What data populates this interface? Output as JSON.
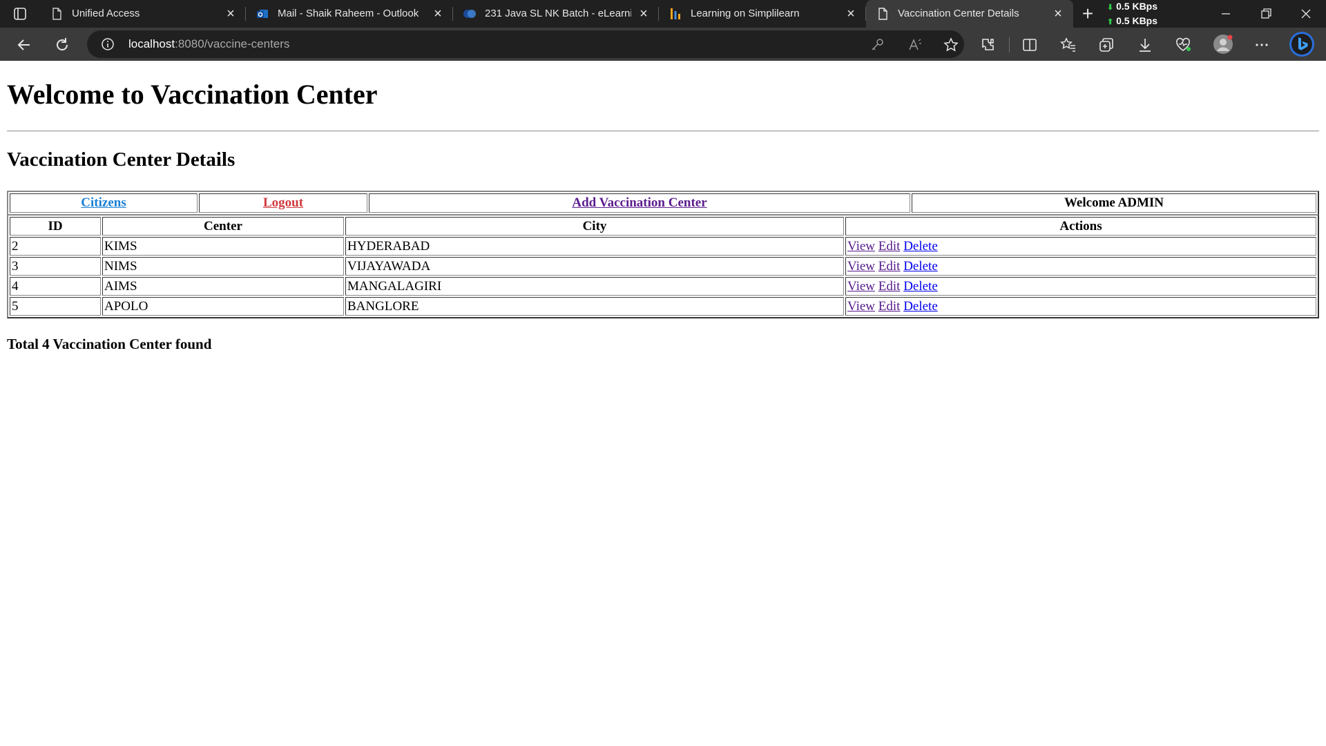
{
  "browser": {
    "tabs": [
      {
        "title": "Unified Access",
        "icon": "page-icon",
        "active": false
      },
      {
        "title": "Mail - Shaik Raheem - Outlook",
        "icon": "outlook-icon",
        "active": false
      },
      {
        "title": "231 Java SL NK Batch - eLearning",
        "icon": "webex-icon",
        "active": false
      },
      {
        "title": "Learning on Simplilearn",
        "icon": "simplilearn-icon",
        "active": false
      },
      {
        "title": "Vaccination Center Details",
        "icon": "page-icon",
        "active": true
      }
    ],
    "network": {
      "down": "0.5 KBps",
      "up": "0.5 KBps"
    },
    "url": {
      "host": "localhost",
      "path": ":8080/vaccine-centers"
    }
  },
  "page": {
    "heading": "Welcome to Vaccination Center",
    "subheading": "Vaccination Center Details",
    "nav": {
      "citizens": "Citizens",
      "logout": "Logout",
      "add_center": "Add Vaccination Center",
      "welcome": "Welcome ADMIN"
    },
    "table": {
      "headers": [
        "ID",
        "Center",
        "City",
        "Actions"
      ],
      "rows": [
        {
          "id": "2",
          "center": "KIMS",
          "city": "HYDERABAD"
        },
        {
          "id": "3",
          "center": "NIMS",
          "city": "VIJAYAWADA"
        },
        {
          "id": "4",
          "center": "AIMS",
          "city": "MANGALAGIRI"
        },
        {
          "id": "5",
          "center": "APOLO",
          "city": "BANGLORE"
        }
      ],
      "actions": {
        "view": "View",
        "edit": "Edit",
        "delete": "Delete"
      }
    },
    "total": "Total 4 Vaccination Center found"
  },
  "colors": {
    "chrome_dark": "#202020",
    "toolbar": "#3b3b3b",
    "link_citizens": "#1a7fd4",
    "link_logout": "#d2383c",
    "link_add": "#5b1d8e",
    "link_visited": "#551a8b",
    "link_unvisited": "#0000ee"
  }
}
